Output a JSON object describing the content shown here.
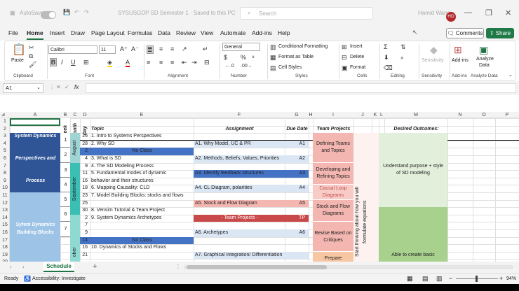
{
  "window": {
    "autosave_label": "AutoSave",
    "file_title": "SYSUSGDP SD Semester 1 · Saved to this PC",
    "search_placeholder": "Search",
    "user_name": "Hamid Wang",
    "avatar_initials": "HD"
  },
  "tabs": [
    "File",
    "Home",
    "Insert",
    "Draw",
    "Page Layout",
    "Formulas",
    "Data",
    "Review",
    "View",
    "Automate",
    "Add-ins",
    "Help"
  ],
  "active_tab": "Home",
  "comments_label": "Comments",
  "share_label": "Share",
  "ribbon": {
    "clipboard": {
      "label": "Clipboard",
      "paste": "Paste"
    },
    "font": {
      "label": "Font",
      "name": "Calibri",
      "size": "11"
    },
    "alignment": {
      "label": "Alignment"
    },
    "number": {
      "label": "Number",
      "format": "General"
    },
    "styles": {
      "label": "Styles",
      "conditional": "Conditional Formatting",
      "table": "Format as Table",
      "cell": "Cell Styles"
    },
    "cells": {
      "label": "Cells",
      "insert": "Insert",
      "delete": "Delete",
      "format": "Format"
    },
    "editing": {
      "label": "Editing"
    },
    "sensitivity": {
      "label": "Sensitivity",
      "button": "Sensitivity"
    },
    "addins": {
      "label": "Add-ins",
      "button": "Add-ins"
    },
    "analyze": {
      "label": "Analyze Data",
      "line1": "Analyze",
      "line2": "Data"
    }
  },
  "formula_bar": {
    "name_box": "A1",
    "fx": "fx",
    "content": ""
  },
  "columns": [
    "A",
    "B",
    "C",
    "D",
    "E",
    "F",
    "G",
    "H",
    "I",
    "J",
    "K",
    "L",
    "M",
    "N",
    "O",
    "P"
  ],
  "headers": {
    "week": "Week",
    "month": "Month",
    "day": "Day",
    "topic": "Topic",
    "assignment": "Assignment",
    "due": "Due Date",
    "team": "Team Projects",
    "outcomes": "Desired Outcomes:"
  },
  "section_labels": [
    "System Dynamics",
    "Perspectives and",
    "Process",
    "Sytem Dynamics",
    "Building Blocks"
  ],
  "months": [
    "August",
    "September",
    "ober"
  ],
  "weeks": [
    "1",
    "2",
    "3",
    "4",
    "5",
    "6",
    "7"
  ],
  "rows": [
    {
      "day": "26",
      "topic": "1. Intro to Systems Perspectives",
      "assignment": "",
      "due": ""
    },
    {
      "day": "28",
      "topic": "2. Why SD",
      "assignment": "A1. Why Model, UC & PR",
      "due": "A1"
    },
    {
      "day": "2",
      "topic": "No Class",
      "assignment": "",
      "due": ""
    },
    {
      "day": "4",
      "topic": "3. What is SD",
      "assignment": "A2. Methods, Beliefs, Values, Priorities",
      "due": "A2"
    },
    {
      "day": "9",
      "topic": "4. The SD Modeling Process",
      "assignment": "",
      "due": ""
    },
    {
      "day": "11",
      "topic": "5. Fundamental modes of dynamic",
      "assignment": "A3. Identify feedback structures",
      "due": "A3"
    },
    {
      "day": "16",
      "topic": "behavior and their structures",
      "assignment": "",
      "due": ""
    },
    {
      "day": "18",
      "topic": "6. Mapping Causality:  CLD",
      "assignment": "A4. CL Diagram, polarities",
      "due": "A4"
    },
    {
      "day": "23",
      "topic": "7. Model Building Blocks: stocks and flows",
      "assignment": "",
      "due": ""
    },
    {
      "day": "25",
      "topic": "",
      "assignment": "A5. Stock and Flow Diagram",
      "due": "A5"
    },
    {
      "day": "30",
      "topic": "8. Vensim Tutorial & Team Project",
      "assignment": "",
      "due": ""
    },
    {
      "day": "2",
      "topic": "9. System Dynamics Archetypes",
      "assignment": "- Team Projects -",
      "due": "TP"
    },
    {
      "day": "7",
      "topic": "",
      "assignment": "",
      "due": ""
    },
    {
      "day": "9",
      "topic": "",
      "assignment": "A6. Archetypes",
      "due": "A6"
    },
    {
      "day": "14",
      "topic": "No Class",
      "assignment": "",
      "due": ""
    },
    {
      "day": "16",
      "topic": "10. Dynamics of Stocks and Flows",
      "assignment": "",
      "due": ""
    },
    {
      "day": "21",
      "topic": "",
      "assignment": "A7. Graphical Integration/ Differentiation",
      "due": ""
    }
  ],
  "team_projects": [
    "Defining Teams and Topics",
    "Developing and Refining Topics",
    "Causal Loop Diagrams",
    "Stock and Flow Diagrams",
    "Revise Based on Critiques",
    "Prepare"
  ],
  "vertical_note": "Start thinking about how you will formulate equations",
  "outcomes": [
    "Understand purpose + style of SD modeling",
    "Able to create basic"
  ],
  "sheet_tab": "Schedule",
  "status": {
    "ready": "Ready",
    "accessibility": "Accessibility: Investigate",
    "zoom": "94%"
  },
  "colors": {
    "excel_green": "#217346",
    "navy": "#2f5597",
    "light_blue": "#9dc3e6",
    "highlight_blue": "#4472c4",
    "teal": "#3bbfb5",
    "salmon": "#f4b6b0",
    "light_green": "#e2efda",
    "mid_green": "#a9d18e",
    "red_bar": "#c9484a"
  }
}
